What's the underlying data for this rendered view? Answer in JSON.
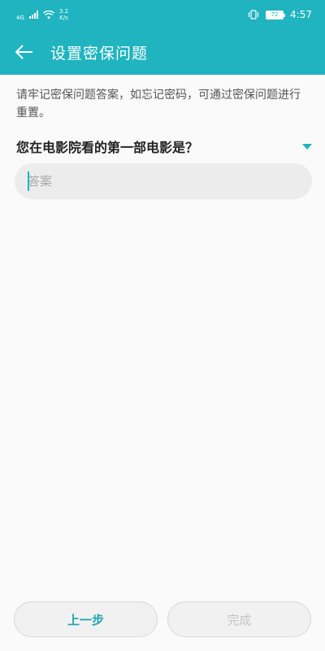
{
  "status_bar": {
    "network": "4G",
    "speed_value": "3.2",
    "speed_unit": "K/s",
    "battery": "72",
    "time": "4:57"
  },
  "app_bar": {
    "back_icon": "arrow-left-icon",
    "title": "设置密保问题"
  },
  "hint": "请牢记密保问题答案，如忘记密码，可通过密保问题进行重置。",
  "question": {
    "text": "您在电影院看的第一部电影是？",
    "dropdown_icon": "triangle-down-icon"
  },
  "answer": {
    "placeholder": "答案",
    "value": ""
  },
  "buttons": {
    "prev": "上一步",
    "done": "完成"
  },
  "colors": {
    "primary": "#1fb4bf",
    "background": "#fafafa",
    "input_bg": "#ececec",
    "disabled_text": "#c4c4c4"
  }
}
